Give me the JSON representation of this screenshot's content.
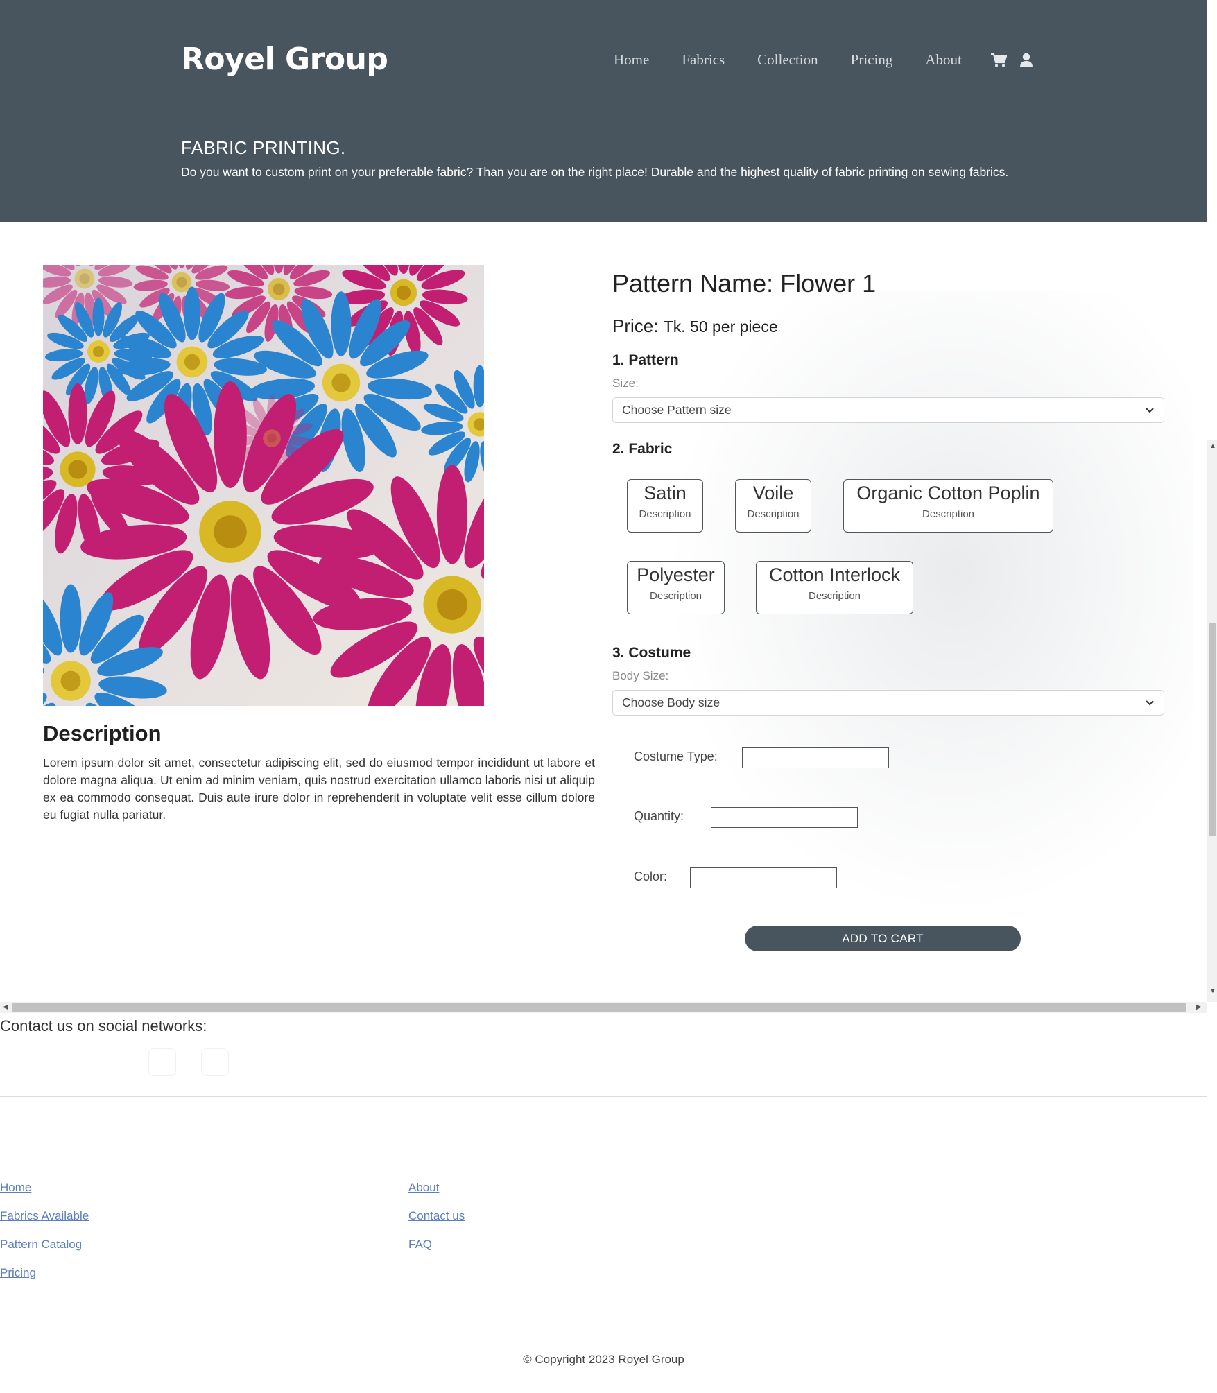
{
  "header": {
    "brand": "Royel Group",
    "nav": [
      "Home",
      "Fabrics",
      "Collection",
      "Pricing",
      "About"
    ],
    "icons": [
      "cart-icon",
      "user-icon"
    ]
  },
  "hero": {
    "title": "FABRIC PRINTING.",
    "text": "Do you want to custom print on your preferable fabric? Than you are on the right place! Durable and the highest quality of fabric printing on sewing fabrics."
  },
  "product": {
    "pattern_name": "Pattern Name: Flower 1",
    "price_label": "Price:",
    "price_value": "Tk. 50 per piece",
    "description_heading": "Description",
    "description_text": "Lorem ipsum dolor sit amet, consectetur adipiscing elit, sed do eiusmod tempor incididunt ut labore et dolore magna aliqua. Ut enim ad minim veniam, quis nostrud exercitation ullamco laboris nisi ut aliquip ex ea commodo consequat. Duis aute irure dolor in reprehenderit in voluptate velit esse cillum dolore eu fugiat nulla pariatur."
  },
  "pattern": {
    "title": "1. Pattern",
    "size_label": "Size:",
    "size_select": "Choose Pattern size"
  },
  "fabric": {
    "title": "2. Fabric",
    "options": [
      {
        "name": "Satin",
        "desc": "Description"
      },
      {
        "name": "Voile",
        "desc": "Description"
      },
      {
        "name": "Organic Cotton Poplin",
        "desc": "Description"
      },
      {
        "name": "Polyester",
        "desc": "Description"
      },
      {
        "name": "Cotton Interlock",
        "desc": "Description"
      }
    ]
  },
  "costume": {
    "title": "3. Costume",
    "body_size_label": "Body Size:",
    "body_size_select": "Choose Body size",
    "type_label": "Costume Type:",
    "quantity_label": "Quantity:",
    "color_label": "Color:",
    "add_to_cart": "ADD TO CART"
  },
  "footer": {
    "social_label": "Contact us on social networks:",
    "links_col1": [
      "Home",
      "Fabrics Available",
      "Pattern Catalog",
      "Pricing"
    ],
    "links_col2": [
      "About",
      "Contact us",
      "FAQ"
    ],
    "copyright": "© Copyright 2023 Royel Group"
  },
  "colors": {
    "header_bg": "#48555e",
    "button_bg": "#48555e",
    "link": "#5a7ec0"
  }
}
